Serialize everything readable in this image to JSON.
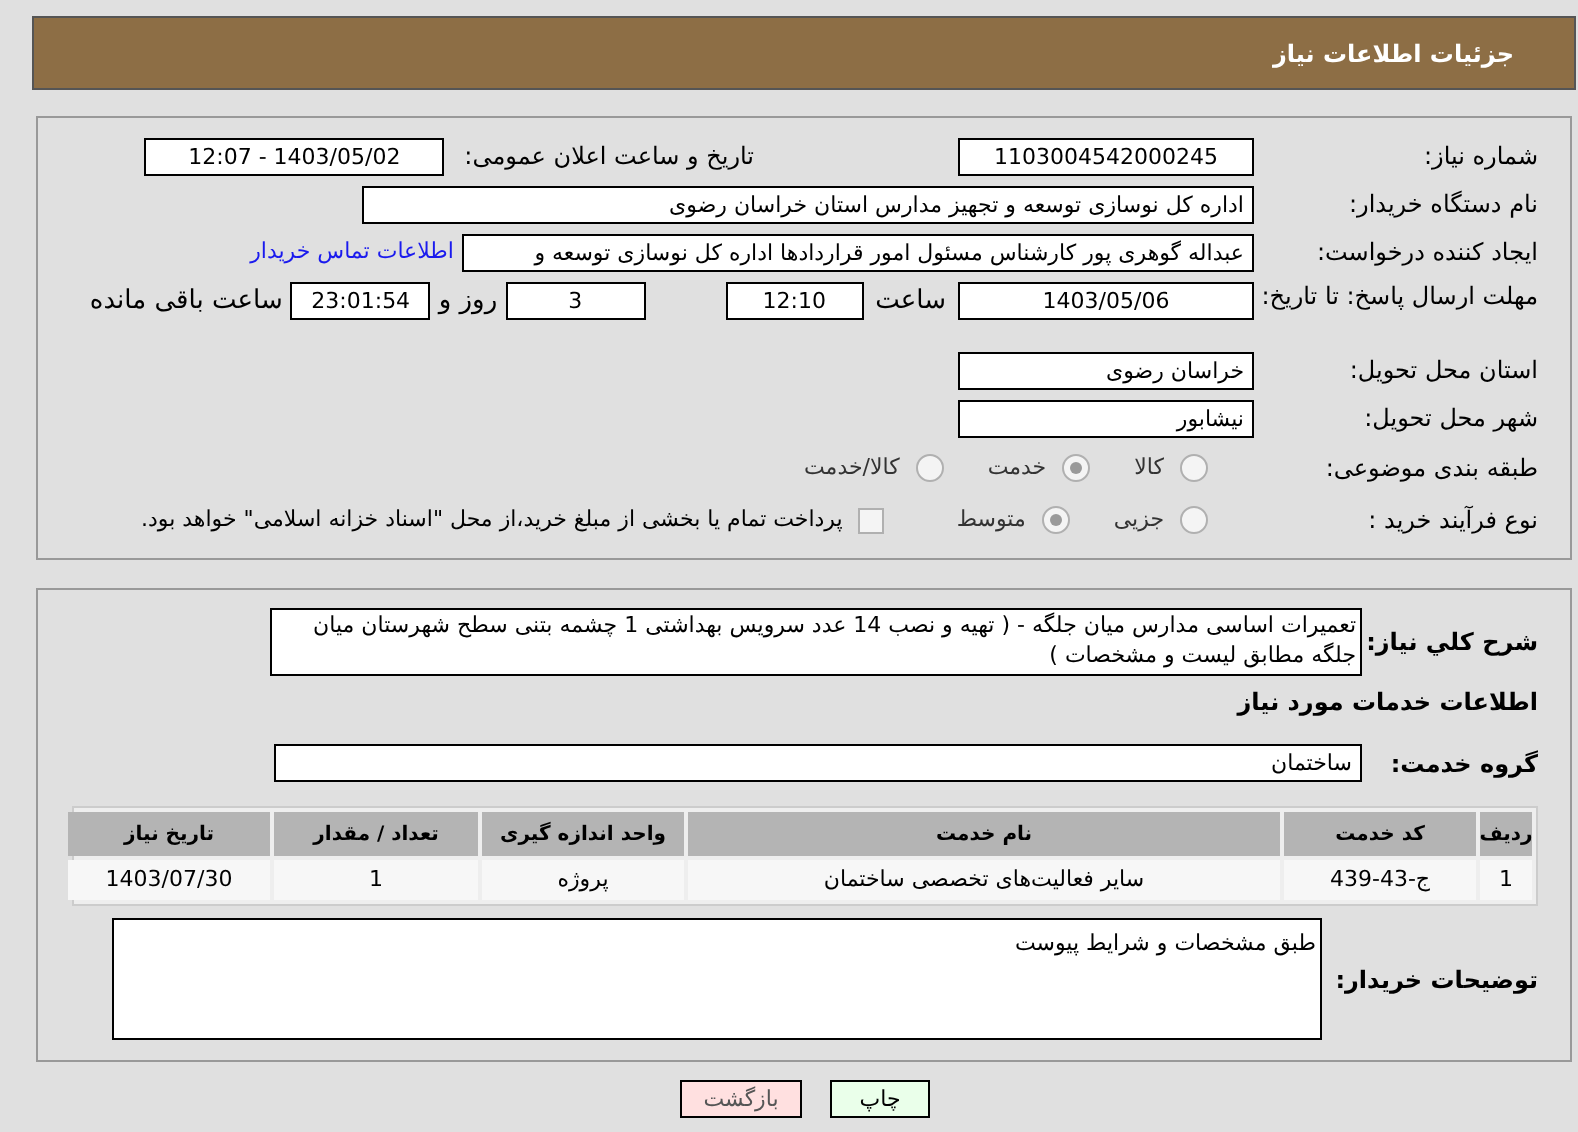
{
  "header": {
    "title": "جزئیات اطلاعات نیاز"
  },
  "need_number": {
    "label": "شماره نیاز:",
    "value": "1103004542000245"
  },
  "announce_datetime": {
    "label": "تاریخ و ساعت اعلان عمومی:",
    "value": "1403/05/02 - 12:07"
  },
  "buyer_org": {
    "label": "نام دستگاه خریدار:",
    "value": "اداره کل نوسازی  توسعه و تجهیز مدارس استان خراسان رضوی"
  },
  "requester": {
    "label": "ایجاد کننده درخواست:",
    "value": "عبداله گوهری پور کارشناس مسئول امور قراردادها  اداره کل نوسازی  توسعه و",
    "link": "اطلاعات تماس خریدار"
  },
  "deadline": {
    "label": "مهلت ارسال پاسخ: تا تاریخ:",
    "date": "1403/05/06",
    "time_label": "ساعت",
    "time": "12:10",
    "days": "3",
    "days_label": "روز و",
    "remaining": "23:01:54",
    "remaining_label": "ساعت باقی مانده"
  },
  "province": {
    "label": "استان محل تحویل:",
    "value": "خراسان رضوی"
  },
  "city": {
    "label": "شهر محل تحویل:",
    "value": "نیشابور"
  },
  "category": {
    "label": "طبقه بندی موضوعی:",
    "options": [
      {
        "label": "کالا",
        "selected": false
      },
      {
        "label": "خدمت",
        "selected": true
      },
      {
        "label": "کالا/خدمت",
        "selected": false
      }
    ]
  },
  "purchase_process": {
    "label": "نوع فرآیند خرید :",
    "options": [
      {
        "label": "جزیی",
        "selected": false
      },
      {
        "label": "متوسط",
        "selected": true
      }
    ],
    "treasury": {
      "checked": false,
      "text": "پرداخت تمام یا بخشی از مبلغ خرید،از محل \"اسناد خزانه اسلامی\" خواهد بود."
    }
  },
  "description": {
    "label": "شرح کلي نياز:",
    "value": "تعمیرات اساسی مدارس میان جلگه - ( تهیه و نصب 14 عدد سرویس بهداشتی 1 چشمه بتنی سطح شهرستان میان جلگه مطابق لیست و مشخصات )"
  },
  "services_title": "اطلاعات خدمات مورد نیاز",
  "service_group": {
    "label": "گروه خدمت:",
    "value": "ساختمان"
  },
  "table": {
    "columns": [
      "ردیف",
      "کد خدمت",
      "نام خدمت",
      "واحد اندازه گیری",
      "تعداد / مقدار",
      "تاریخ نیاز"
    ],
    "rows": [
      [
        "1",
        "ج-43-439",
        "سایر فعالیت‌های تخصصی ساختمان",
        "پروژه",
        "1",
        "1403/07/30"
      ]
    ]
  },
  "buyer_notes": {
    "label": "توضیحات خریدار:",
    "value": "طبق مشخصات و شرایط پیوست"
  },
  "buttons": {
    "print": "چاپ",
    "back": "بازگشت"
  }
}
